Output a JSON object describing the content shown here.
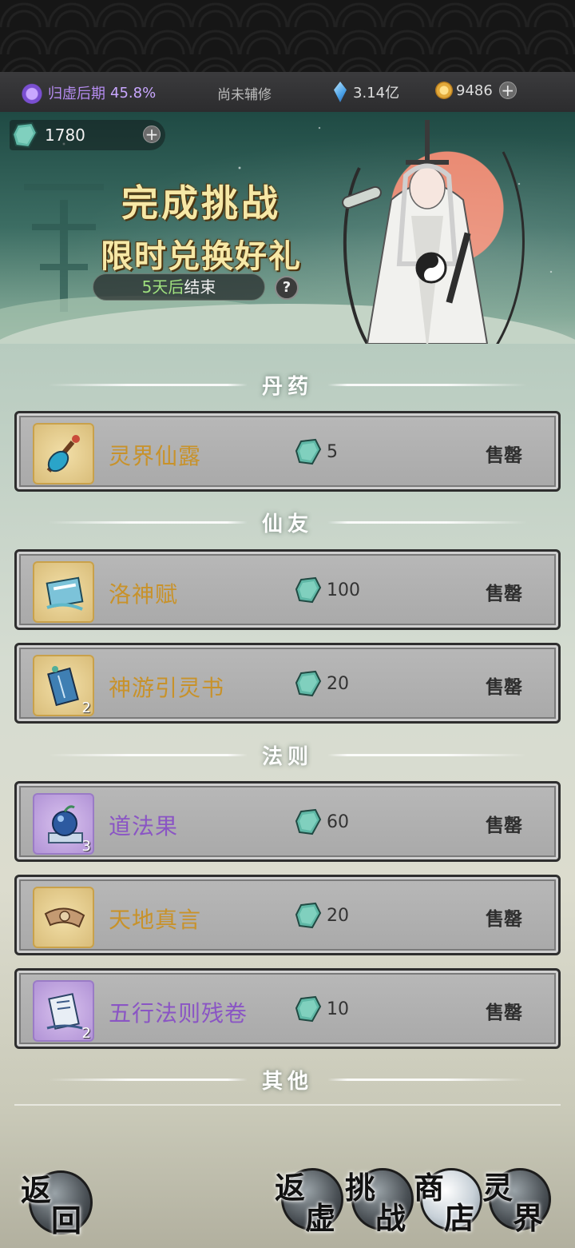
{
  "status_bar": {
    "realm": "归虚后期",
    "realm_progress": "45.8%",
    "assist_status": "尚未辅修",
    "crystals": "3.14亿",
    "coins": "9486"
  },
  "banner": {
    "jade_balance": "1780",
    "title_line1": "完成挑战",
    "title_line2": "限时兑换好礼",
    "timer_days": "5天后",
    "timer_suffix": "结束",
    "help_label": "?"
  },
  "sections": [
    {
      "name": "丹药"
    },
    {
      "name": "仙友"
    },
    {
      "name": "法则"
    },
    {
      "name": "其他"
    }
  ],
  "items": [
    {
      "name": "灵界仙露",
      "price": "5",
      "status": "售罄",
      "count": "",
      "rarity": "gold",
      "icon": "potion-icon"
    },
    {
      "name": "洛神赋",
      "price": "100",
      "status": "售罄",
      "count": "",
      "rarity": "gold",
      "icon": "book-icon"
    },
    {
      "name": "神游引灵书",
      "price": "20",
      "status": "售罄",
      "count": "2",
      "rarity": "gold",
      "icon": "scroll-icon"
    },
    {
      "name": "道法果",
      "price": "60",
      "status": "售罄",
      "count": "3",
      "rarity": "purple",
      "icon": "orb-icon"
    },
    {
      "name": "天地真言",
      "price": "20",
      "status": "售罄",
      "count": "",
      "rarity": "gold",
      "icon": "ribbon-icon"
    },
    {
      "name": "五行法则残卷",
      "price": "10",
      "status": "售罄",
      "count": "2",
      "rarity": "purple",
      "icon": "scroll-icon"
    }
  ],
  "nav": {
    "back": [
      "返",
      "回"
    ],
    "return_void": [
      "返",
      "虚"
    ],
    "challenge": [
      "挑",
      "战"
    ],
    "shop": [
      "商",
      "店"
    ],
    "spirit_realm": [
      "灵",
      "界"
    ]
  },
  "colors": {
    "gold_name": "#c8922a",
    "purple_name": "#8a55c4",
    "timer_green": "#9fe07e",
    "realm_purple": "#b58cf0"
  }
}
